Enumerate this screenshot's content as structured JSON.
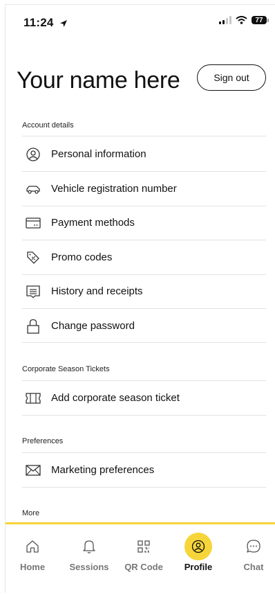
{
  "status_bar": {
    "time": "11:24",
    "battery": "77"
  },
  "header": {
    "title": "Your name here",
    "sign_out_label": "Sign out"
  },
  "sections": [
    {
      "label": "Account details",
      "items": [
        {
          "label": "Personal information",
          "icon": "user-circle-icon"
        },
        {
          "label": "Vehicle registration number",
          "icon": "car-icon"
        },
        {
          "label": "Payment methods",
          "icon": "card-icon"
        },
        {
          "label": "Promo codes",
          "icon": "tag-percent-icon"
        },
        {
          "label": "History and receipts",
          "icon": "receipt-icon"
        },
        {
          "label": "Change password",
          "icon": "lock-icon"
        }
      ]
    },
    {
      "label": "Corporate Season Tickets",
      "items": [
        {
          "label": "Add corporate season ticket",
          "icon": "ticket-icon"
        }
      ]
    },
    {
      "label": "Preferences",
      "items": [
        {
          "label": "Marketing preferences",
          "icon": "envelope-icon"
        }
      ]
    },
    {
      "label": "More",
      "items": []
    }
  ],
  "tabbar": {
    "accent": "#f6d53a",
    "tabs": [
      {
        "label": "Home",
        "icon": "home-icon",
        "active": false
      },
      {
        "label": "Sessions",
        "icon": "bell-icon",
        "active": false
      },
      {
        "label": "QR Code",
        "icon": "qr-code-icon",
        "active": false
      },
      {
        "label": "Profile",
        "icon": "profile-icon",
        "active": true
      },
      {
        "label": "Chat",
        "icon": "chat-icon",
        "active": false
      }
    ]
  }
}
